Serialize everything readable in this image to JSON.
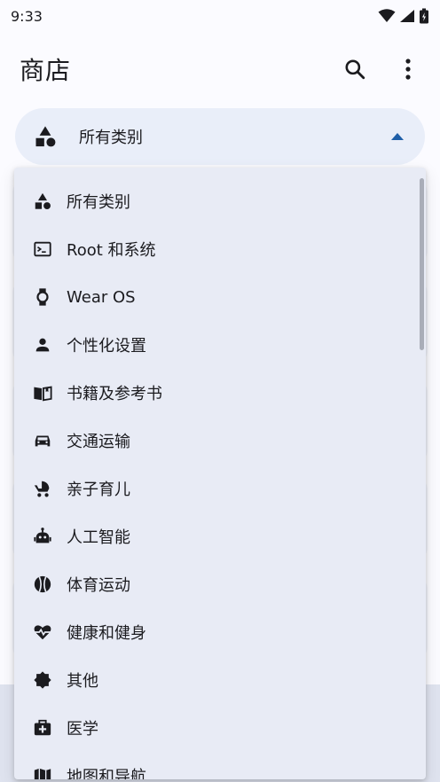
{
  "status_bar": {
    "time": "9:33"
  },
  "app_bar": {
    "title": "商店"
  },
  "selector": {
    "label": "所有类别"
  },
  "menu": {
    "items": [
      {
        "label": "所有类别",
        "icon": "category-icon"
      },
      {
        "label": "Root 和系统",
        "icon": "terminal-icon"
      },
      {
        "label": "Wear OS",
        "icon": "watch-icon"
      },
      {
        "label": "个性化设置",
        "icon": "person-icon"
      },
      {
        "label": "书籍及参考书",
        "icon": "book-icon"
      },
      {
        "label": "交通运输",
        "icon": "car-icon"
      },
      {
        "label": "亲子育儿",
        "icon": "stroller-icon"
      },
      {
        "label": "人工智能",
        "icon": "robot-icon"
      },
      {
        "label": "体育运动",
        "icon": "sports-ball-icon"
      },
      {
        "label": "健康和健身",
        "icon": "heart-pulse-icon"
      },
      {
        "label": "其他",
        "icon": "badge-icon"
      },
      {
        "label": "医学",
        "icon": "medical-bag-icon"
      },
      {
        "label": "地图和导航",
        "icon": "map-icon"
      }
    ]
  }
}
